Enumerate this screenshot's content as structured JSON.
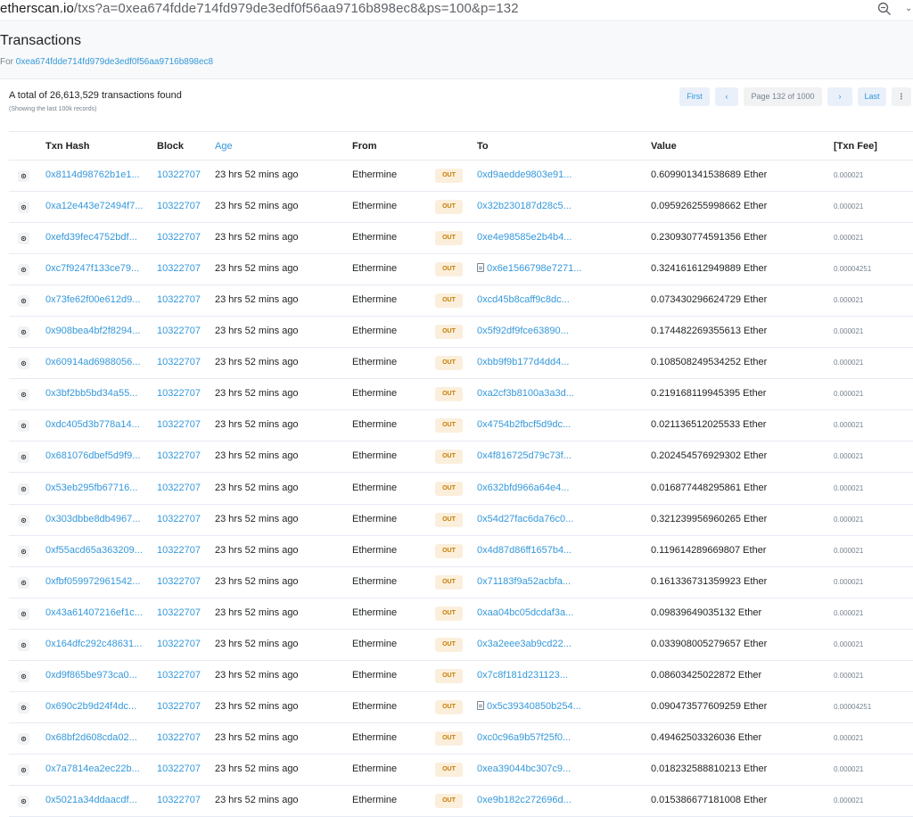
{
  "browser": {
    "url_domain": "etherscan.io",
    "url_path": "/txs?a=0xea674fdde714fd979de3edf0f56aa9716b898ec8&ps=100&p=132"
  },
  "header": {
    "title": "Transactions",
    "for_label": "For",
    "address": "0xea674fdde714fd979de3edf0f56aa9716b898ec8"
  },
  "summary": {
    "total": "A total of 26,613,529 transactions found",
    "showing": "(Showing the last 100k records)"
  },
  "pager": {
    "first": "First",
    "prev": "‹",
    "page_info": "Page 132 of 1000",
    "next": "›",
    "last": "Last",
    "more": "⋮"
  },
  "table": {
    "columns": {
      "txn_hash": "Txn Hash",
      "block": "Block",
      "age": "Age",
      "from": "From",
      "to": "To",
      "value": "Value",
      "fee": "[Txn Fee]"
    },
    "rows": [
      {
        "hash": "0x8114d98762b1e1...",
        "block": "10322707",
        "age": "23 hrs 52 mins ago",
        "from": "Ethermine",
        "dir": "OUT",
        "to": "0xd9aedde9803e91...",
        "contract": false,
        "value": "0.609901341538689 Ether",
        "fee": "0.000021"
      },
      {
        "hash": "0xa12e443e72494f7...",
        "block": "10322707",
        "age": "23 hrs 52 mins ago",
        "from": "Ethermine",
        "dir": "OUT",
        "to": "0x32b230187d28c5...",
        "contract": false,
        "value": "0.095926255998662 Ether",
        "fee": "0.000021"
      },
      {
        "hash": "0xefd39fec4752bdf...",
        "block": "10322707",
        "age": "23 hrs 52 mins ago",
        "from": "Ethermine",
        "dir": "OUT",
        "to": "0xe4e98585e2b4b4...",
        "contract": false,
        "value": "0.230930774591356 Ether",
        "fee": "0.000021"
      },
      {
        "hash": "0xc7f9247f133ce79...",
        "block": "10322707",
        "age": "23 hrs 52 mins ago",
        "from": "Ethermine",
        "dir": "OUT",
        "to": "0x6e1566798e7271...",
        "contract": true,
        "value": "0.324161612949889 Ether",
        "fee": "0.00004251"
      },
      {
        "hash": "0x73fe62f00e612d9...",
        "block": "10322707",
        "age": "23 hrs 52 mins ago",
        "from": "Ethermine",
        "dir": "OUT",
        "to": "0xcd45b8caff9c8dc...",
        "contract": false,
        "value": "0.073430296624729 Ether",
        "fee": "0.000021"
      },
      {
        "hash": "0x908bea4bf2f8294...",
        "block": "10322707",
        "age": "23 hrs 52 mins ago",
        "from": "Ethermine",
        "dir": "OUT",
        "to": "0x5f92df9fce63890...",
        "contract": false,
        "value": "0.174482269355613 Ether",
        "fee": "0.000021"
      },
      {
        "hash": "0x60914ad6988056...",
        "block": "10322707",
        "age": "23 hrs 52 mins ago",
        "from": "Ethermine",
        "dir": "OUT",
        "to": "0xbb9f9b177d4dd4...",
        "contract": false,
        "value": "0.108508249534252 Ether",
        "fee": "0.000021"
      },
      {
        "hash": "0x3bf2bb5bd34a55...",
        "block": "10322707",
        "age": "23 hrs 52 mins ago",
        "from": "Ethermine",
        "dir": "OUT",
        "to": "0xa2cf3b8100a3a3d...",
        "contract": false,
        "value": "0.219168119945395 Ether",
        "fee": "0.000021"
      },
      {
        "hash": "0xdc405d3b778a14...",
        "block": "10322707",
        "age": "23 hrs 52 mins ago",
        "from": "Ethermine",
        "dir": "OUT",
        "to": "0x4754b2fbcf5d9dc...",
        "contract": false,
        "value": "0.021136512025533 Ether",
        "fee": "0.000021"
      },
      {
        "hash": "0x681076dbef5d9f9...",
        "block": "10322707",
        "age": "23 hrs 52 mins ago",
        "from": "Ethermine",
        "dir": "OUT",
        "to": "0x4f816725d79c73f...",
        "contract": false,
        "value": "0.202454576929302 Ether",
        "fee": "0.000021"
      },
      {
        "hash": "0x53eb295fb67716...",
        "block": "10322707",
        "age": "23 hrs 52 mins ago",
        "from": "Ethermine",
        "dir": "OUT",
        "to": "0x632bfd966a64e4...",
        "contract": false,
        "value": "0.016877448295861 Ether",
        "fee": "0.000021"
      },
      {
        "hash": "0x303dbbe8db4967...",
        "block": "10322707",
        "age": "23 hrs 52 mins ago",
        "from": "Ethermine",
        "dir": "OUT",
        "to": "0x54d27fac6da76c0...",
        "contract": false,
        "value": "0.321239956960265 Ether",
        "fee": "0.000021"
      },
      {
        "hash": "0xf55acd65a363209...",
        "block": "10322707",
        "age": "23 hrs 52 mins ago",
        "from": "Ethermine",
        "dir": "OUT",
        "to": "0x4d87d86ff1657b4...",
        "contract": false,
        "value": "0.119614289669807 Ether",
        "fee": "0.000021"
      },
      {
        "hash": "0xfbf059972961542...",
        "block": "10322707",
        "age": "23 hrs 52 mins ago",
        "from": "Ethermine",
        "dir": "OUT",
        "to": "0x71183f9a52acbfa...",
        "contract": false,
        "value": "0.161336731359923 Ether",
        "fee": "0.000021"
      },
      {
        "hash": "0x43a61407216ef1c...",
        "block": "10322707",
        "age": "23 hrs 52 mins ago",
        "from": "Ethermine",
        "dir": "OUT",
        "to": "0xaa04bc05dcdaf3a...",
        "contract": false,
        "value": "0.09839649035132 Ether",
        "fee": "0.000021"
      },
      {
        "hash": "0x164dfc292c48631...",
        "block": "10322707",
        "age": "23 hrs 52 mins ago",
        "from": "Ethermine",
        "dir": "OUT",
        "to": "0x3a2eee3ab9cd22...",
        "contract": false,
        "value": "0.033908005279657 Ether",
        "fee": "0.000021"
      },
      {
        "hash": "0xd9f865be973ca0...",
        "block": "10322707",
        "age": "23 hrs 52 mins ago",
        "from": "Ethermine",
        "dir": "OUT",
        "to": "0x7c8f181d231123...",
        "contract": false,
        "value": "0.08603425022872 Ether",
        "fee": "0.000021"
      },
      {
        "hash": "0x690c2b9d24f4dc...",
        "block": "10322707",
        "age": "23 hrs 52 mins ago",
        "from": "Ethermine",
        "dir": "OUT",
        "to": "0x5c39340850b254...",
        "contract": true,
        "value": "0.090473577609259 Ether",
        "fee": "0.00004251"
      },
      {
        "hash": "0x68bf2d608cda02...",
        "block": "10322707",
        "age": "23 hrs 52 mins ago",
        "from": "Ethermine",
        "dir": "OUT",
        "to": "0xc0c96a9b57f25f0...",
        "contract": false,
        "value": "0.49462503326036 Ether",
        "fee": "0.000021"
      },
      {
        "hash": "0x7a7814ea2ec22b...",
        "block": "10322707",
        "age": "23 hrs 52 mins ago",
        "from": "Ethermine",
        "dir": "OUT",
        "to": "0xea39044bc307c9...",
        "contract": false,
        "value": "0.018232588810213 Ether",
        "fee": "0.000021"
      },
      {
        "hash": "0x5021a34ddaacdf...",
        "block": "10322707",
        "age": "23 hrs 52 mins ago",
        "from": "Ethermine",
        "dir": "OUT",
        "to": "0xe9b182c272696d...",
        "contract": false,
        "value": "0.015386677181008 Ether",
        "fee": "0.000021"
      }
    ]
  },
  "colors": {
    "link": "#3498db",
    "out_badge_bg": "#fbefdc",
    "out_badge_text": "#c77c02"
  }
}
